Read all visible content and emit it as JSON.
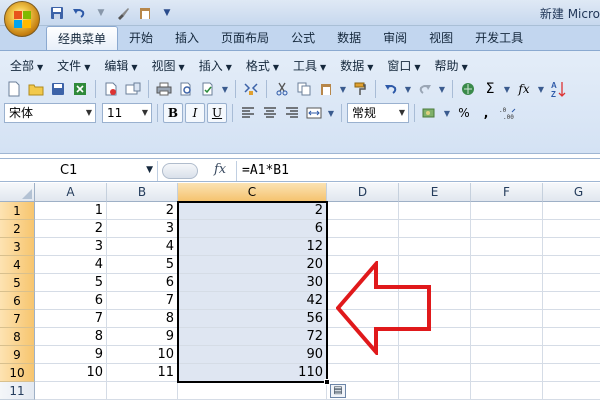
{
  "title": "新建 Micro",
  "qat_icons": [
    "save-icon",
    "undo-icon",
    "redo-icon",
    "brush-icon",
    "paste-icon"
  ],
  "tabs": [
    "经典菜单",
    "开始",
    "插入",
    "页面布局",
    "公式",
    "数据",
    "审阅",
    "视图",
    "开发工具"
  ],
  "active_tab": "经典菜单",
  "menus": [
    "全部",
    "文件",
    "编辑",
    "视图",
    "插入",
    "格式",
    "工具",
    "数据",
    "窗口",
    "帮助"
  ],
  "toolbar": {
    "font_name": "宋体",
    "font_size": "11",
    "bold": "B",
    "italic": "I",
    "underline": "U",
    "number_format": "常规",
    "percent": "%",
    "comma": ",",
    "sum": "Σ",
    "fx": "fx",
    "sort": "A Z"
  },
  "formula_bar": {
    "name_box": "C1",
    "fx_label": "fx",
    "formula": "=A1*B1"
  },
  "columns": [
    "A",
    "B",
    "C",
    "D",
    "E",
    "F",
    "G"
  ],
  "selected_column": "C",
  "rows": [
    {
      "n": "1",
      "a": "1",
      "b": "2",
      "c": "2"
    },
    {
      "n": "2",
      "a": "2",
      "b": "3",
      "c": "6"
    },
    {
      "n": "3",
      "a": "3",
      "b": "4",
      "c": "12"
    },
    {
      "n": "4",
      "a": "4",
      "b": "5",
      "c": "20"
    },
    {
      "n": "5",
      "a": "5",
      "b": "6",
      "c": "30"
    },
    {
      "n": "6",
      "a": "6",
      "b": "7",
      "c": "42"
    },
    {
      "n": "7",
      "a": "7",
      "b": "8",
      "c": "56"
    },
    {
      "n": "8",
      "a": "8",
      "b": "9",
      "c": "72"
    },
    {
      "n": "9",
      "a": "9",
      "b": "10",
      "c": "90"
    },
    {
      "n": "10",
      "a": "10",
      "b": "11",
      "c": "110"
    }
  ],
  "extra_row": {
    "n": "11"
  },
  "colors": {
    "selection_fill": "#dfe6f2",
    "header_highlight": "#f5c36f",
    "arrow": "#e0191b"
  }
}
